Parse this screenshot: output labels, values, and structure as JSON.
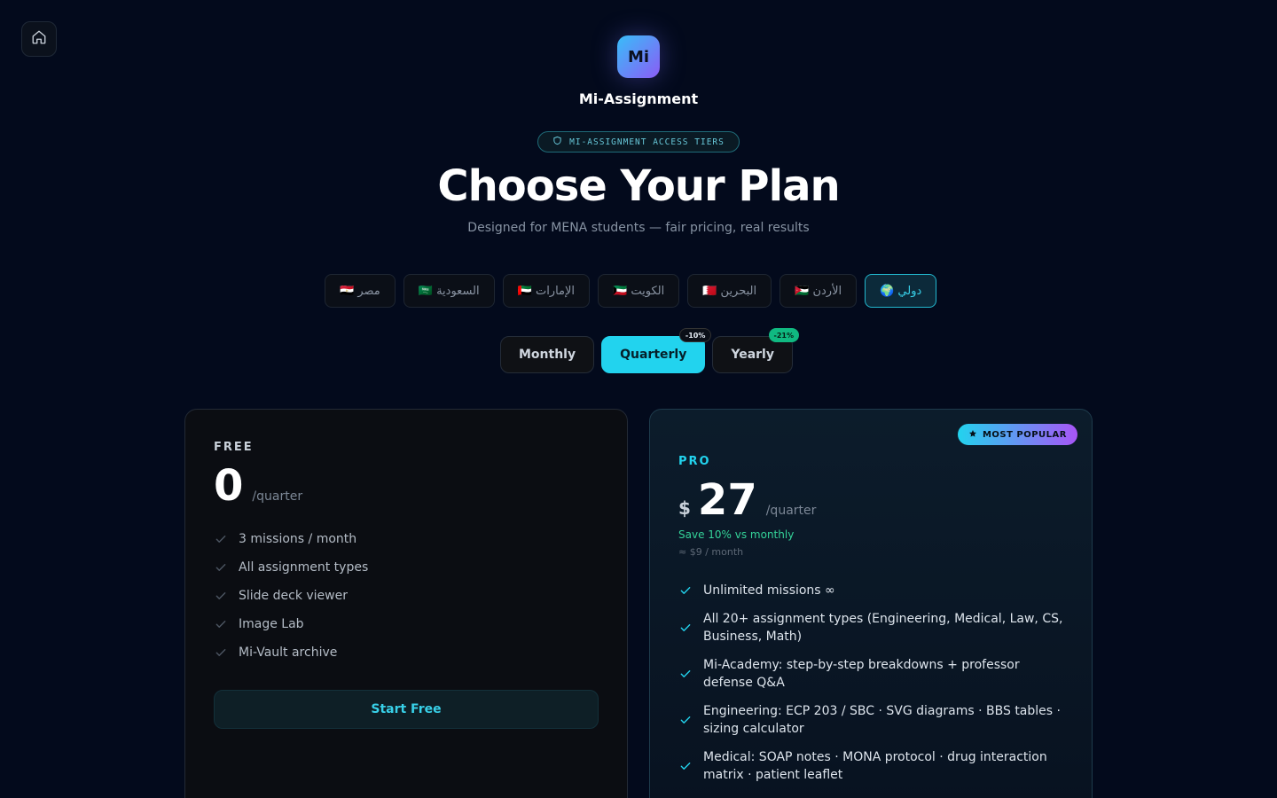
{
  "brand": {
    "logo_text": "Mi",
    "name": "Mi-Assignment"
  },
  "hero": {
    "eyebrow": "MI-ASSIGNMENT ACCESS TIERS",
    "title": "Choose Your Plan",
    "subtitle": "Designed for MENA students — fair pricing, real results"
  },
  "countries": [
    {
      "label": "🇪🇬 مصر",
      "active": false
    },
    {
      "label": "🇸🇦 السعودية",
      "active": false
    },
    {
      "label": "🇦🇪 الإمارات",
      "active": false
    },
    {
      "label": "🇰🇼 الكويت",
      "active": false
    },
    {
      "label": "🇧🇭 البحرين",
      "active": false
    },
    {
      "label": "🇯🇴 الأردن",
      "active": false
    },
    {
      "label": "🌍 دولي",
      "active": true
    }
  ],
  "billing_periods": [
    {
      "label": "Monthly",
      "active": false,
      "badge": ""
    },
    {
      "label": "Quarterly",
      "active": true,
      "badge": "-10%"
    },
    {
      "label": "Yearly",
      "active": false,
      "badge": "-21%"
    }
  ],
  "plans": {
    "free": {
      "name": "FREE",
      "price": "0",
      "period": "/quarter",
      "features": [
        "3 missions / month",
        "All assignment types",
        "Slide deck viewer",
        "Image Lab",
        "Mi-Vault archive"
      ],
      "cta": "Start Free"
    },
    "pro": {
      "badge": "MOST POPULAR",
      "name": "PRO",
      "currency": "$",
      "price": "27",
      "period": "/quarter",
      "savings": "Save 10% vs monthly",
      "monthly_equivalent": "≈ $9 / month",
      "features": [
        "Unlimited missions ∞",
        "All 20+ assignment types (Engineering, Medical, Law, CS, Business, Math)",
        "Mi-Academy: step-by-step breakdowns + professor defense Q&A",
        "Engineering: ECP 203 / SBC · SVG diagrams · BBS tables · sizing calculator",
        "Medical: SOAP notes · MONA protocol · drug interaction matrix · patient leaflet"
      ]
    }
  },
  "colors": {
    "accent": "#22d3ee",
    "success": "#34d399",
    "background": "#030a1c"
  }
}
